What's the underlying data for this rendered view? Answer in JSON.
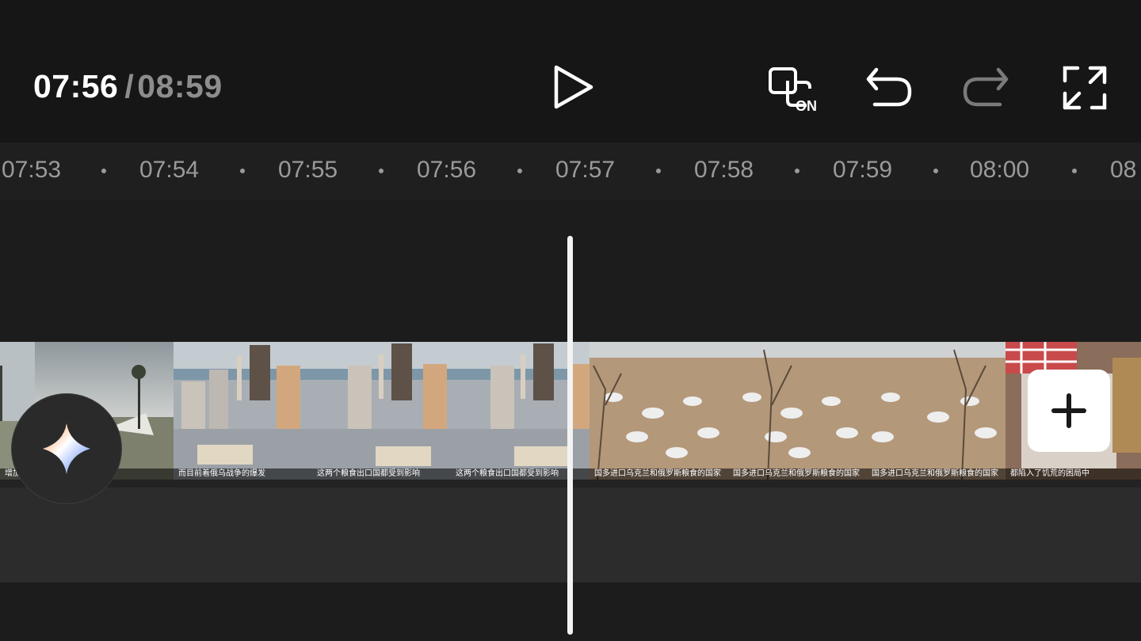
{
  "player": {
    "current_time": "07:56",
    "separator": "/",
    "total_time": "08:59"
  },
  "controls": {
    "play_icon": "play-icon",
    "toggle_icon": "mirror-on-icon",
    "toggle_label": "ON",
    "undo_icon": "undo-icon",
    "redo_icon": "redo-icon",
    "fullscreen_icon": "fullscreen-icon"
  },
  "ruler": {
    "labels": [
      "07:53",
      "07:54",
      "07:55",
      "07:56",
      "07:57",
      "07:58",
      "07:59",
      "08:00",
      "08"
    ]
  },
  "clips": [
    {
      "scene": "coast",
      "caption": "增加"
    },
    {
      "scene": "coast",
      "caption": "战争的爆发"
    },
    {
      "scene": "city",
      "caption": "而目前着俄乌战争的爆发"
    },
    {
      "scene": "city",
      "caption": "这两个粮食出口国都受到影响"
    },
    {
      "scene": "city",
      "caption": "这两个粮食出口国都受到影响"
    },
    {
      "scene": "camp",
      "caption": "国多进口乌克兰和俄罗斯粮食的国家"
    },
    {
      "scene": "camp",
      "caption": "国多进口乌克兰和俄罗斯粮食的国家"
    },
    {
      "scene": "camp",
      "caption": "国多进口乌克兰和俄罗斯粮食的国家"
    },
    {
      "scene": "cloth",
      "caption": "都陷入了饥荒的困局中"
    }
  ],
  "ai_button_icon": "sparkle-icon",
  "add_button_icon": "plus-icon"
}
